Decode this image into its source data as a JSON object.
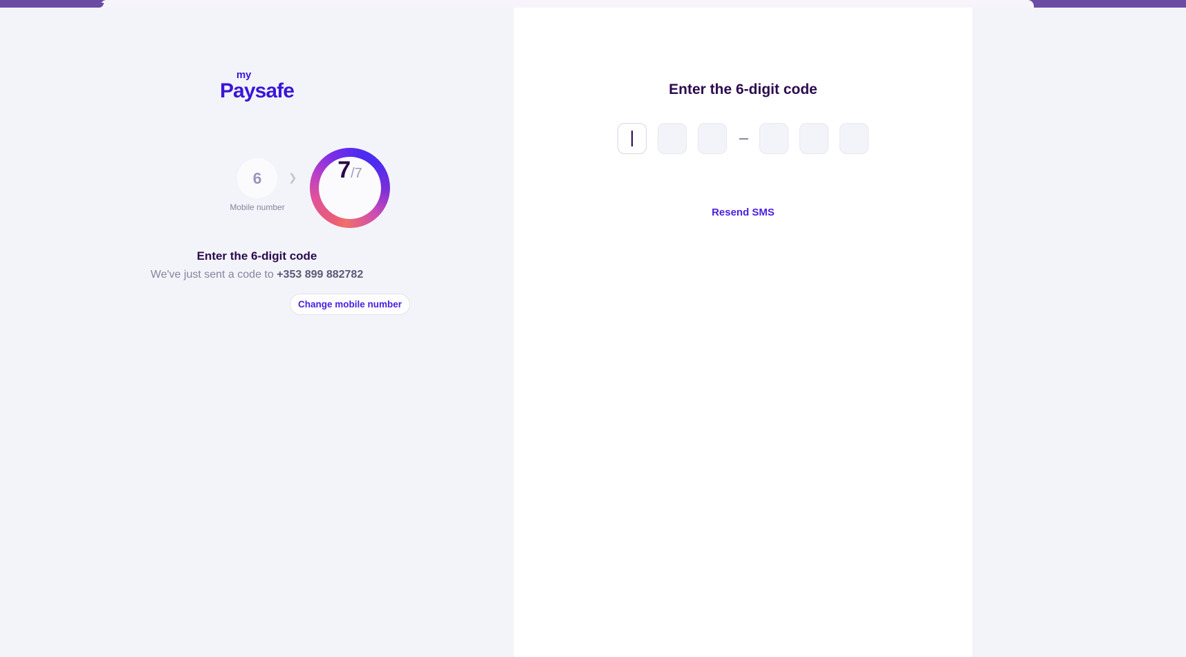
{
  "browser": {
    "tab_bar_color": "#6b4ba3",
    "tab_color": "#f7f4fb"
  },
  "brand": {
    "logo_line1": "my",
    "logo_line2": "Paysafe",
    "logo_color": "#3b16d8"
  },
  "left_panel": {
    "stepper": {
      "previous_step_number": "6",
      "previous_step_label": "Mobile number",
      "chevron_icon": "chevron-right",
      "current_step_number": "7",
      "current_step_total": "/7"
    },
    "title": "Enter the 6-digit code",
    "subtitle_prefix": "We've just sent a code to ",
    "phone_number": "+353 899 882782",
    "change_button_label": "Change mobile number"
  },
  "right_panel": {
    "title": "Enter the 6-digit code",
    "otp": {
      "boxes": [
        {
          "value": "",
          "focused": true
        },
        {
          "value": "",
          "focused": false
        },
        {
          "value": "",
          "focused": false
        },
        {
          "separator": "—"
        },
        {
          "value": "",
          "focused": false
        },
        {
          "value": "",
          "focused": false
        },
        {
          "value": "",
          "focused": false
        }
      ],
      "digit_count": 6
    },
    "resend_label": "Resend SMS"
  },
  "colors": {
    "page_background": "#f3f4f9",
    "panel_background": "#ffffff",
    "heading": "#2c0a4e",
    "accent": "#4b20e0",
    "muted_text": "#87849f",
    "ring_gradient_start": "#ec5f74",
    "ring_gradient_end": "#4d2bf0"
  }
}
